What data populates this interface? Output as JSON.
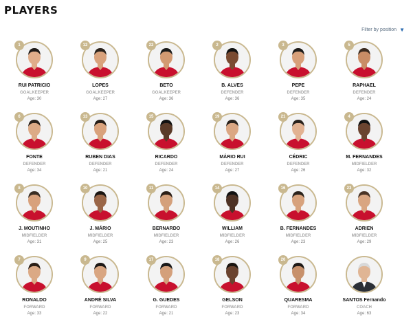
{
  "header": {
    "title": "PLAYERS"
  },
  "filter": {
    "label": "Filter by position",
    "icon": "caret-down-icon"
  },
  "colors": {
    "ring": "#c9b88f",
    "shirt": "#c8102e",
    "coach_suit": "#2b2f36"
  },
  "players": [
    {
      "number": "1",
      "name": "RUI PATRICIO",
      "position": "GOALKEEPER",
      "age": "Age: 30"
    },
    {
      "number": "12",
      "name": "LOPES",
      "position": "GOALKEEPER",
      "age": "Age: 27"
    },
    {
      "number": "22",
      "name": "BETO",
      "position": "GOALKEEPER",
      "age": "Age: 36"
    },
    {
      "number": "2",
      "name": "B. ALVES",
      "position": "DEFENDER",
      "age": "Age: 36"
    },
    {
      "number": "3",
      "name": "PEPE",
      "position": "DEFENDER",
      "age": "Age: 35"
    },
    {
      "number": "5",
      "name": "RAPHAEL",
      "position": "DEFENDER",
      "age": "Age: 24"
    },
    {
      "number": "6",
      "name": "FONTE",
      "position": "DEFENDER",
      "age": "Age: 34"
    },
    {
      "number": "13",
      "name": "RUBEN DIAS",
      "position": "DEFENDER",
      "age": "Age: 21"
    },
    {
      "number": "15",
      "name": "RICARDO",
      "position": "DEFENDER",
      "age": "Age: 24"
    },
    {
      "number": "19",
      "name": "MÁRIO RUI",
      "position": "DEFENDER",
      "age": "Age: 27"
    },
    {
      "number": "21",
      "name": "CÉDRIC",
      "position": "DEFENDER",
      "age": "Age: 26"
    },
    {
      "number": "4",
      "name": "M. FERNANDES",
      "position": "MIDFIELDER",
      "age": "Age: 32"
    },
    {
      "number": "8",
      "name": "J. MOUTINHO",
      "position": "MIDFIELDER",
      "age": "Age: 31"
    },
    {
      "number": "10",
      "name": "J. MÁRIO",
      "position": "MIDFIELDER",
      "age": "Age: 25"
    },
    {
      "number": "11",
      "name": "BERNARDO",
      "position": "MIDFIELDER",
      "age": "Age: 23"
    },
    {
      "number": "14",
      "name": "WILLIAM",
      "position": "MIDFIELDER",
      "age": "Age: 26"
    },
    {
      "number": "16",
      "name": "B. FERNANDES",
      "position": "MIDFIELDER",
      "age": "Age: 23"
    },
    {
      "number": "23",
      "name": "ADRIEN",
      "position": "MIDFIELDER",
      "age": "Age: 29"
    },
    {
      "number": "7",
      "name": "RONALDO",
      "position": "FORWARD",
      "age": "Age: 33"
    },
    {
      "number": "9",
      "name": "ANDRÉ SILVA",
      "position": "FORWARD",
      "age": "Age: 22"
    },
    {
      "number": "17",
      "name": "G. GUEDES",
      "position": "FORWARD",
      "age": "Age: 21"
    },
    {
      "number": "18",
      "name": "GELSON",
      "position": "FORWARD",
      "age": "Age: 23"
    },
    {
      "number": "20",
      "name": "QUARESMA",
      "position": "FORWARD",
      "age": "Age: 34"
    },
    {
      "number": "",
      "name": "SANTOS Fernando",
      "position": "COACH",
      "age": "Age: 63"
    }
  ]
}
